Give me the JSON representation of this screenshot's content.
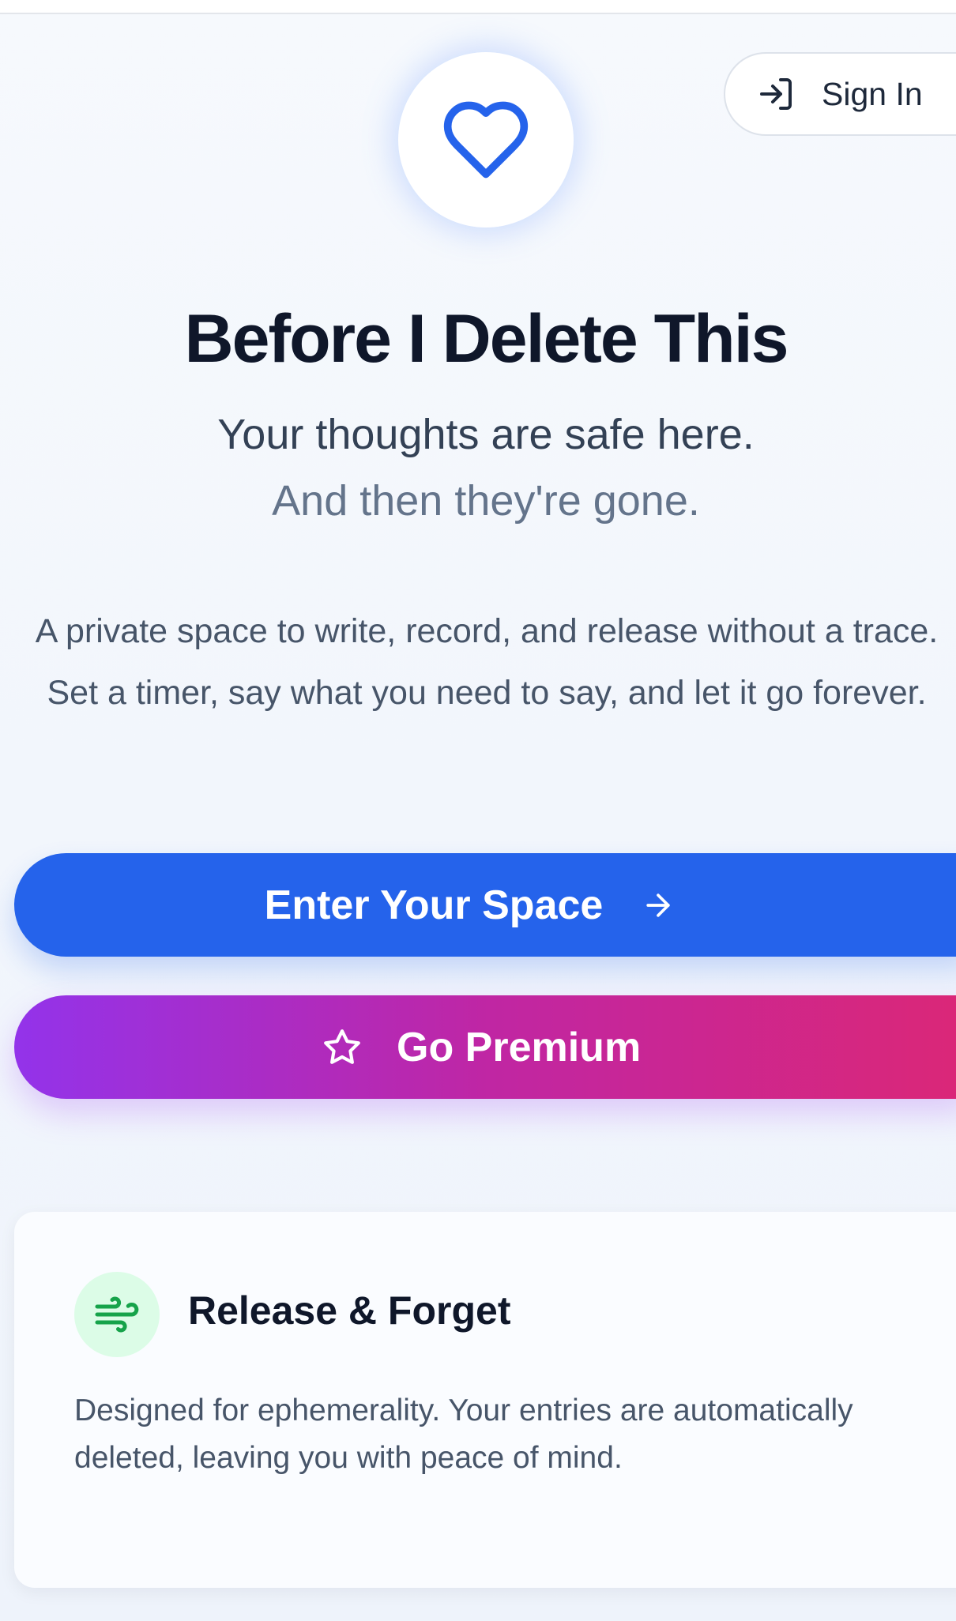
{
  "header": {
    "sign_in_label": "Sign In"
  },
  "hero": {
    "title": "Before I Delete This",
    "subtitle_line1": "Your thoughts are safe here.",
    "subtitle_line2": "And then they're gone.",
    "description": "A private space to write, record, and release without a trace. Set a timer, say what you need to say, and let it go forever."
  },
  "actions": {
    "enter_label": "Enter Your Space",
    "premium_label": "Go Premium"
  },
  "features": [
    {
      "icon": "wind-icon",
      "title": "Release & Forget",
      "description": "Designed for ephemerality. Your entries are automatically deleted, leaving you with peace of mind."
    }
  ],
  "icons": {
    "logo": "heart-icon",
    "sign_in": "log-in-icon",
    "enter": "arrow-right-icon",
    "premium": "star-icon"
  },
  "colors": {
    "primary": "#2563eb",
    "premium_start": "#9333ea",
    "premium_end": "#db2777",
    "feature_icon_bg": "#dcfce7",
    "feature_icon": "#16a34a"
  }
}
